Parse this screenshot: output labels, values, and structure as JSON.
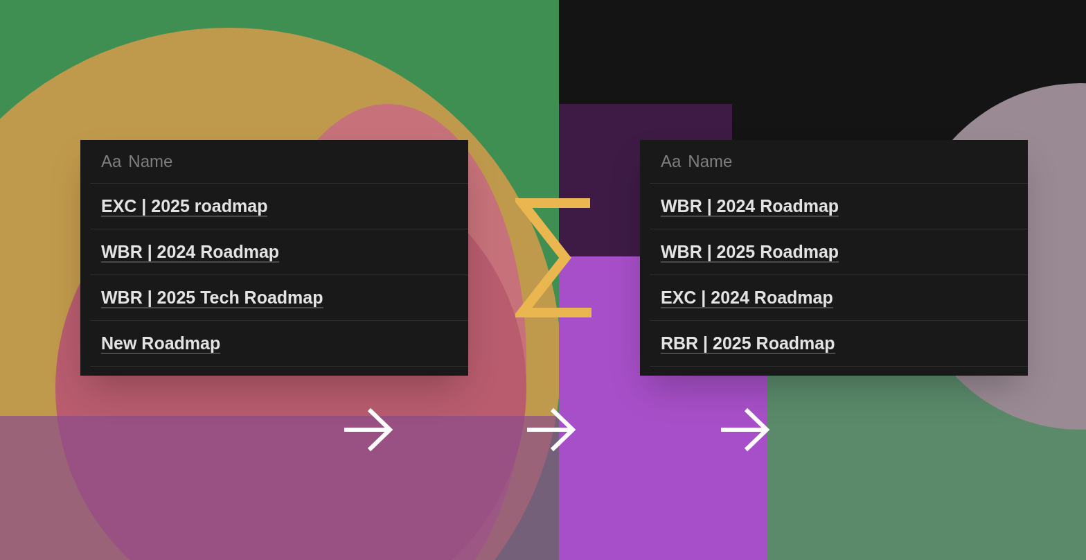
{
  "tables": [
    {
      "header": {
        "type_glyph": "Aa",
        "label": "Name"
      },
      "rows": [
        "EXC | 2025 roadmap",
        "WBR | 2024 Roadmap",
        "WBR | 2025 Tech Roadmap",
        "New Roadmap"
      ]
    },
    {
      "header": {
        "type_glyph": "Aa",
        "label": "Name"
      },
      "rows": [
        "WBR | 2024 Roadmap",
        "WBR | 2025 Roadmap",
        "EXC | 2024 Roadmap",
        "RBR | 2025 Roadmap"
      ]
    }
  ]
}
